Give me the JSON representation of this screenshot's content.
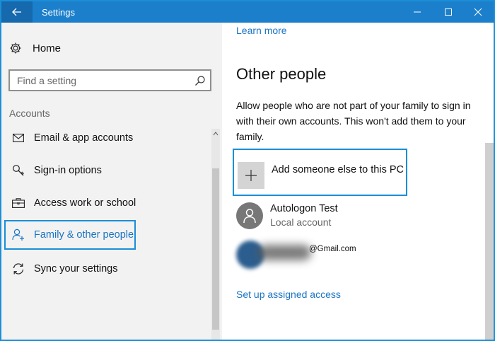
{
  "window": {
    "title": "Settings",
    "accent": "#1c7fcb",
    "buttons": [
      "back-arrow",
      "minimize",
      "maximize",
      "close"
    ]
  },
  "sidebar": {
    "home_label": "Home",
    "search_placeholder": "Find a setting",
    "section_title": "Accounts",
    "items": [
      {
        "label": "Email & app accounts",
        "icon": "mail-icon"
      },
      {
        "label": "Sign-in options",
        "icon": "key-icon"
      },
      {
        "label": "Access work or school",
        "icon": "briefcase-icon"
      },
      {
        "label": "Family & other people",
        "icon": "person-add-icon",
        "selected": true
      },
      {
        "label": "Sync your settings",
        "icon": "sync-icon"
      }
    ]
  },
  "main": {
    "learn_more": "Learn more",
    "heading": "Other people",
    "description": "Allow people who are not part of your family to sign in with their own accounts. This won't add them to your family.",
    "add_label": "Add someone else to this PC",
    "accounts": [
      {
        "name": "Autologon Test",
        "type": "Local account"
      }
    ],
    "blurred_email_suffix": "@Gmail.com",
    "assigned_access_link": "Set up assigned access"
  }
}
